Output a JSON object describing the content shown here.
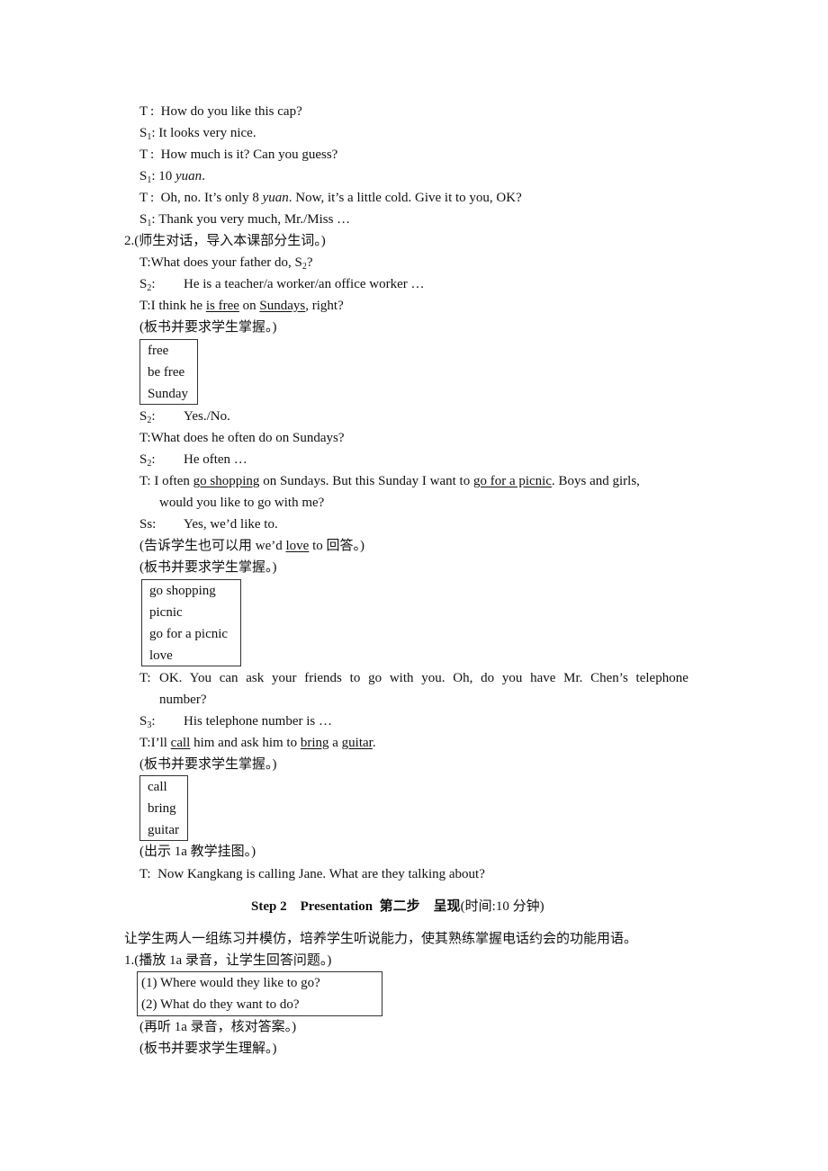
{
  "section1_dialogue": [
    {
      "speaker": "T",
      "text": "How do you like this cap?"
    },
    {
      "speaker": "S",
      "sub": "1",
      "text": "It looks very nice."
    },
    {
      "speaker": "T",
      "text": "How much is it? Can you guess?"
    },
    {
      "speaker": "S",
      "sub": "1",
      "text_pre": "10 ",
      "italic": "yuan",
      "text_post": "."
    },
    {
      "speaker": "T",
      "text_pre": "Oh, no. It’s only 8 ",
      "italic": "yuan",
      "text_post": ". Now, it’s a little cold. Give it to you, OK?"
    },
    {
      "speaker": "S",
      "sub": "1",
      "text": "Thank you very much, Mr./Miss …"
    }
  ],
  "item2": {
    "number": "2.",
    "note": "(师生对话，导入本课部分生词。)",
    "l1": {
      "speaker": "T:",
      "text": "What does your father do, S",
      "sub": "2",
      "post": "?"
    },
    "l2": {
      "speaker": "S",
      "sub": "2",
      "colon": ":",
      "text": "He is a teacher/a worker/an office worker …"
    },
    "l3": {
      "speaker": "T:",
      "pre": "I think he ",
      "u1": "is free",
      "mid": " on ",
      "u2": "Sundays",
      "post": ", right?"
    },
    "board_note": "(板书并要求学生掌握。)",
    "box1": [
      "free",
      "be free",
      "Sunday"
    ],
    "l4": {
      "speaker": "S",
      "sub": "2",
      "colon": ":",
      "text": "Yes./No."
    },
    "l5": {
      "speaker": "T:",
      "text": "What does he often do on Sundays?"
    },
    "l6": {
      "speaker": "S",
      "sub": "2",
      "colon": ":",
      "text": "He often …"
    },
    "l7": {
      "speaker": "T:",
      "pre": "I often ",
      "u1": "go shopping",
      "mid": " on Sundays. But this Sunday I want to ",
      "u2": "go for a picnic",
      "post": ". Boys and girls,",
      "cont": "would you like to go with me?"
    },
    "l8": {
      "speaker": "Ss:",
      "text": "Yes, we’d like to."
    },
    "tell_note": {
      "pre": "(告诉学生也可以用 we’d ",
      "u": "love",
      "post": " to 回答。)"
    },
    "board_note2": "(板书并要求学生掌握。)",
    "box2": [
      "go shopping",
      "picnic",
      "go for a picnic",
      "love"
    ],
    "l9": {
      "speaker": "T:",
      "text": "OK. You can ask your friends to go with you. Oh, do you have Mr. Chen’s telephone",
      "cont": "number?"
    },
    "l10": {
      "speaker": "S",
      "sub": "3",
      "colon": ":",
      "text": "His telephone number is …"
    },
    "l11": {
      "speaker": "T:",
      "pre": "I’ll ",
      "u1": "call",
      "mid": " him and ask him to ",
      "u2": "bring",
      "mid2": " a ",
      "u3": "guitar",
      "post": "."
    },
    "board_note3": "(板书并要求学生掌握。)",
    "box3": [
      "call",
      "bring",
      "guitar"
    ],
    "show_note": "(出示 1a 教学挂图。)",
    "l12": {
      "speaker": "T:",
      "text": "Now Kangkang is calling Jane. What are they talking about?"
    }
  },
  "step2": {
    "heading_en": "Step 2",
    "heading_en2": "Presentation",
    "heading_cn": "第二步",
    "heading_cn2": "呈现",
    "time": "(时间:10 分钟)",
    "intro": "让学生两人一组练习并模仿，培养学生听说能力，使其熟练掌握电话约会的功能用语。",
    "item1_number": "1.",
    "item1_note": "(播放 1a 录音，让学生回答问题。)",
    "questions": [
      "(1) Where would they like to go?",
      "(2) What do they want to do?"
    ],
    "relisten_note": "(再听 1a 录音，核对答案。)",
    "board_note": "(板书并要求学生理解。)"
  }
}
